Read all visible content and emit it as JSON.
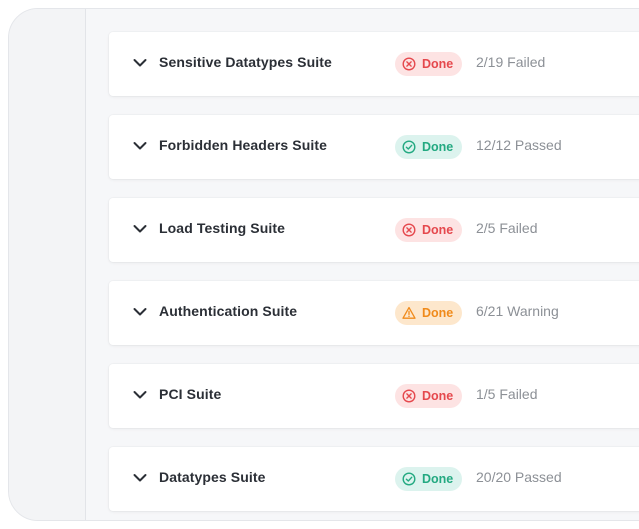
{
  "colors": {
    "failed": "#e5484d",
    "failed_bg": "#fde3e3",
    "passed": "#23a981",
    "passed_bg": "#dcf3ee",
    "warning": "#f08a1a",
    "warning_bg": "#fde7cc"
  },
  "suites": [
    {
      "name": "Sensitive Datatypes Suite",
      "status_label": "Done",
      "status": "failed",
      "status_icon": "x-circle-icon",
      "result": "2/19 Failed"
    },
    {
      "name": "Forbidden Headers Suite",
      "status_label": "Done",
      "status": "passed",
      "status_icon": "check-circle-icon",
      "result": "12/12 Passed"
    },
    {
      "name": "Load Testing Suite",
      "status_label": "Done",
      "status": "failed",
      "status_icon": "x-circle-icon",
      "result": "2/5 Failed"
    },
    {
      "name": "Authentication Suite",
      "status_label": "Done",
      "status": "warning",
      "status_icon": "warning-triangle-icon",
      "result": "6/21 Warning"
    },
    {
      "name": "PCI Suite",
      "status_label": "Done",
      "status": "failed",
      "status_icon": "x-circle-icon",
      "result": "1/5 Failed"
    },
    {
      "name": "Datatypes Suite",
      "status_label": "Done",
      "status": "passed",
      "status_icon": "check-circle-icon",
      "result": "20/20 Passed"
    }
  ]
}
